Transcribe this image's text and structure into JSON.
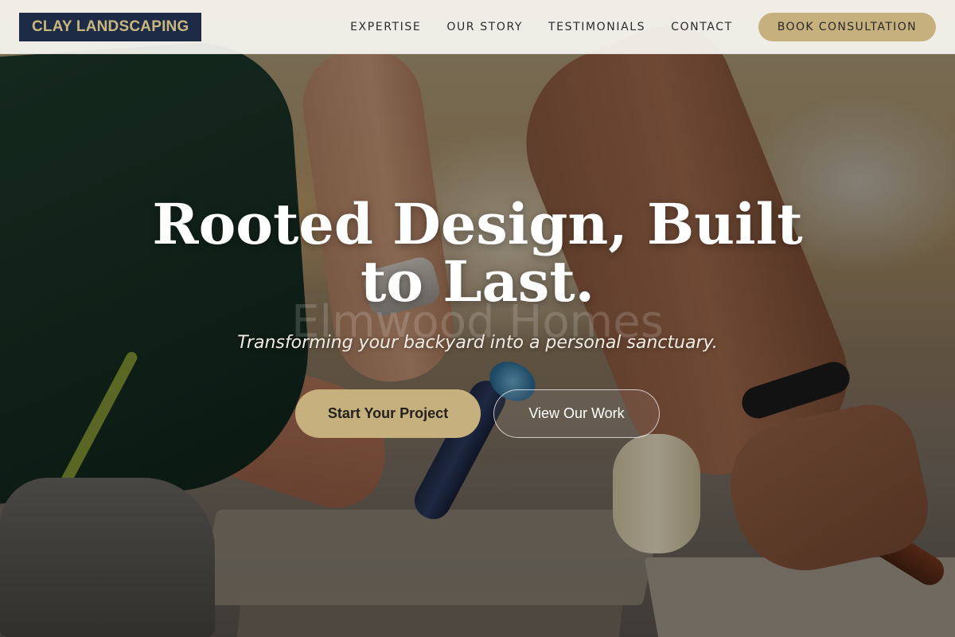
{
  "brand": {
    "logo_text": "CLAY LANDSCAPING",
    "accent_color": "#c6b07e",
    "logo_bg": "#1d2b47"
  },
  "nav": {
    "links": [
      {
        "label": "EXPERTISE"
      },
      {
        "label": "OUR STORY"
      },
      {
        "label": "TESTIMONIALS"
      },
      {
        "label": "CONTACT"
      }
    ],
    "cta_label": "BOOK CONSULTATION"
  },
  "hero": {
    "headline": "Rooted Design, Built to Last.",
    "ghost_text": "Elmwood Homes",
    "subheadline": "Transforming your backyard into a personal sanctuary.",
    "primary_button": "Start Your Project",
    "secondary_button": "View Our Work",
    "image": "hands laying stone pavers with trowel and mallet"
  }
}
